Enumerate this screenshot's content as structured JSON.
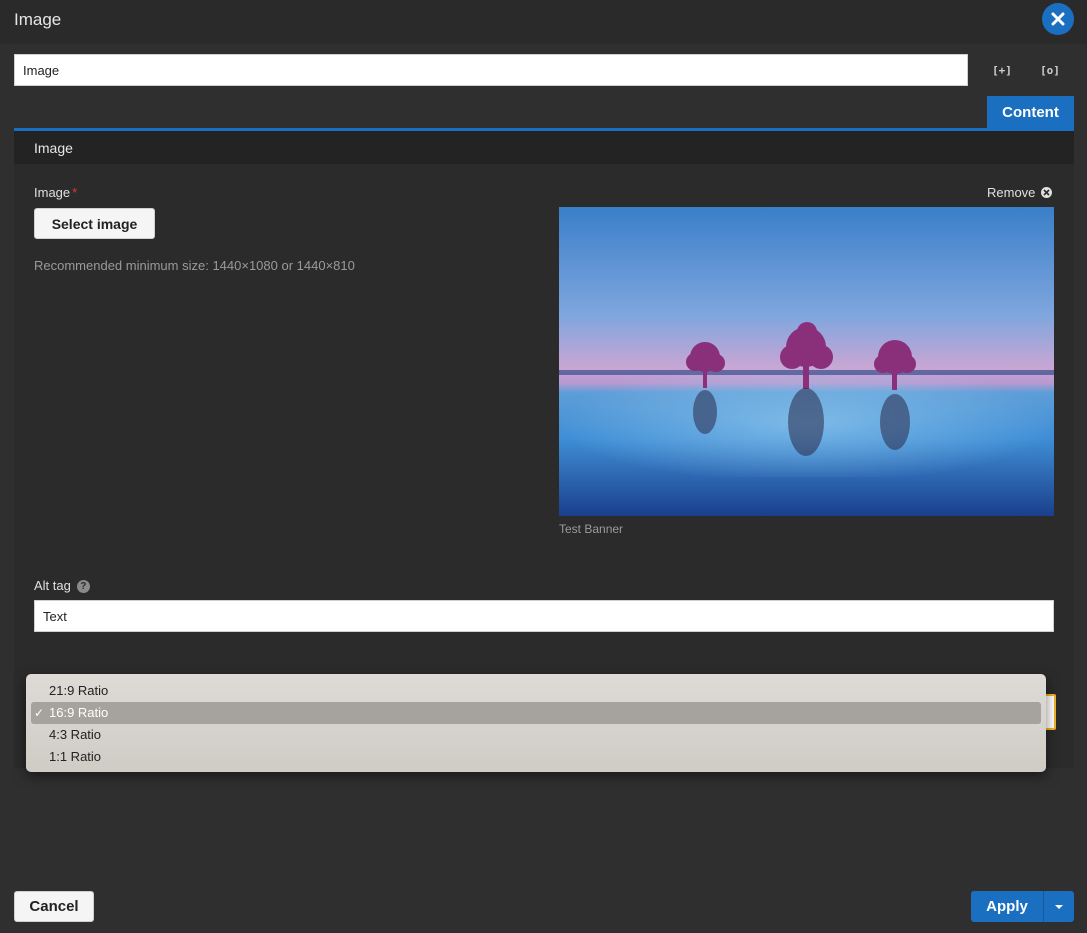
{
  "dialog": {
    "title": "Image",
    "close_icon": "close-icon"
  },
  "name_field": {
    "value": "Image"
  },
  "header_tools": {
    "expand_label": "[+]",
    "focus_label": "[o]"
  },
  "tabs": [
    {
      "label": "Content",
      "active": true
    }
  ],
  "section": {
    "title": "Image"
  },
  "image_field": {
    "label": "Image",
    "required_mark": "*",
    "select_button": "Select image",
    "hint": "Recommended minimum size: 1440×1080 or 1440×810",
    "remove_label": "Remove",
    "caption": "Test Banner"
  },
  "alt_field": {
    "label": "Alt tag",
    "help_icon": "?",
    "value": "Text"
  },
  "ratio_dropdown": {
    "options": [
      "21:9 Ratio",
      "16:9 Ratio",
      "4:3 Ratio",
      "1:1 Ratio"
    ],
    "selected": "16:9 Ratio",
    "check_mark": "✓"
  },
  "footer": {
    "cancel_label": "Cancel",
    "apply_label": "Apply"
  },
  "colors": {
    "accent": "#1a6fc0",
    "focus": "#f0b429",
    "background": "#2f2f2f"
  }
}
